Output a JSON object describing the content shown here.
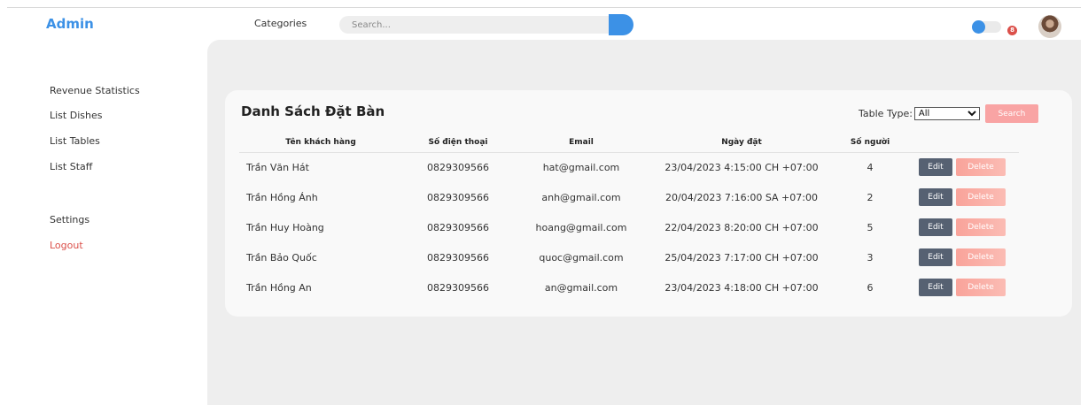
{
  "header": {
    "brand": "Admin",
    "categories_label": "Categories",
    "search_placeholder": "Search...",
    "notification_count": "8"
  },
  "sidebar": {
    "items": [
      {
        "label": "Revenue Statistics"
      },
      {
        "label": "List Dishes"
      },
      {
        "label": "List Tables"
      },
      {
        "label": "List Staff"
      }
    ],
    "settings_label": "Settings",
    "logout_label": "Logout"
  },
  "main": {
    "title": "Danh Sách Đặt Bàn",
    "filter_label": "Table Type:",
    "filter_value": "All",
    "search_button": "Search",
    "columns": [
      "Tên khách hàng",
      "Số điện thoại",
      "Email",
      "Ngày đặt",
      "Số người"
    ],
    "edit_label": "Edit",
    "delete_label": "Delete",
    "rows": [
      {
        "name": "Trần Văn Hát",
        "phone": "0829309566",
        "email": "hat@gmail.com",
        "date": "23/04/2023 4:15:00 CH +07:00",
        "people": "4"
      },
      {
        "name": "Trần Hồng Ánh",
        "phone": "0829309566",
        "email": "anh@gmail.com",
        "date": "20/04/2023 7:16:00 SA +07:00",
        "people": "2"
      },
      {
        "name": "Trần Huy Hoàng",
        "phone": "0829309566",
        "email": "hoang@gmail.com",
        "date": "22/04/2023 8:20:00 CH +07:00",
        "people": "5"
      },
      {
        "name": "Trần Bảo Quốc",
        "phone": "0829309566",
        "email": "quoc@gmail.com",
        "date": "25/04/2023 7:17:00 CH +07:00",
        "people": "3"
      },
      {
        "name": "Trần Hồng An",
        "phone": "0829309566",
        "email": "an@gmail.com",
        "date": "23/04/2023 4:18:00 CH +07:00",
        "people": "6"
      }
    ]
  },
  "colors": {
    "accent": "#3c91e6",
    "danger": "#db504a",
    "edit_button": "#566172",
    "delete_button": "#f9a39a"
  }
}
